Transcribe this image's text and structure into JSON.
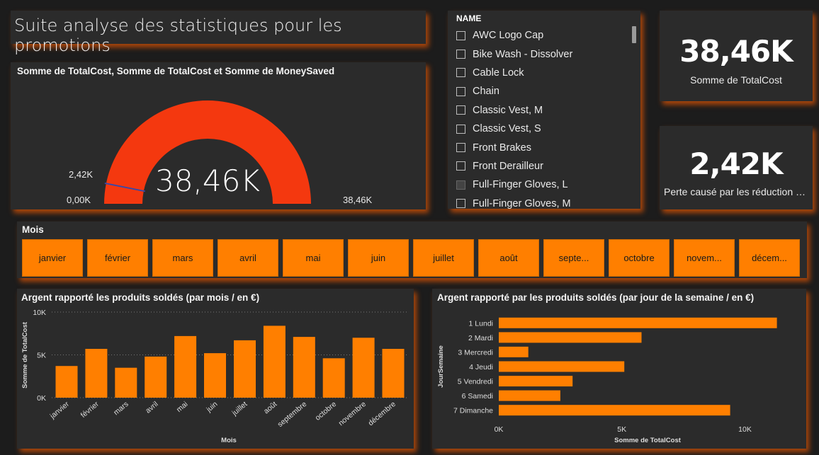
{
  "header": {
    "title": "Suite analyse des statistiques pour les promotions"
  },
  "gauge": {
    "title": "Somme de TotalCost, Somme de TotalCost et Somme de MoneySaved",
    "value_label": "38,46K",
    "min_label": "0,00K",
    "max_label": "38,46K",
    "target_label": "2,42K",
    "value": 38.46,
    "target": 2.42,
    "max": 38.46,
    "color": "#f4380f"
  },
  "slicer": {
    "header": "NAME",
    "items": [
      {
        "label": "AWC Logo Cap",
        "dark": false
      },
      {
        "label": "Bike Wash - Dissolver",
        "dark": false
      },
      {
        "label": "Cable Lock",
        "dark": false
      },
      {
        "label": "Chain",
        "dark": false
      },
      {
        "label": "Classic Vest, M",
        "dark": false
      },
      {
        "label": "Classic Vest, S",
        "dark": false
      },
      {
        "label": "Front Brakes",
        "dark": false
      },
      {
        "label": "Front Derailleur",
        "dark": false
      },
      {
        "label": "Full-Finger Gloves, L",
        "dark": true
      },
      {
        "label": "Full-Finger Gloves, M",
        "dark": false
      }
    ]
  },
  "card1": {
    "value": "38,46K",
    "label": "Somme de TotalCost"
  },
  "card2": {
    "value": "2,42K",
    "label": "Perte causé par les réduction (e..."
  },
  "months": {
    "title": "Mois",
    "items": [
      "janvier",
      "février",
      "mars",
      "avril",
      "mai",
      "juin",
      "juillet",
      "août",
      "septe...",
      "octobre",
      "novem...",
      "décem..."
    ]
  },
  "colors": {
    "accent": "#ff7f00",
    "gauge": "#f4380f",
    "panel": "#2b2b2b",
    "glow": "#c44e08"
  },
  "chart_data": [
    {
      "type": "bar",
      "title": "Argent rapporté les produits soldés (par mois / en €)",
      "xlabel": "Mois",
      "ylabel": "Somme de TotalCost",
      "categories": [
        "janvier",
        "février",
        "mars",
        "avril",
        "mai",
        "juin",
        "juillet",
        "août",
        "septembre",
        "octobre",
        "novembre",
        "décembre"
      ],
      "values": [
        3700,
        5700,
        3500,
        4800,
        7200,
        5200,
        6700,
        8400,
        7100,
        4600,
        7000,
        5700
      ],
      "ylim": [
        0,
        10000
      ],
      "yticks": [
        "0K",
        "5K",
        "10K"
      ],
      "color": "#ff7f00"
    },
    {
      "type": "bar",
      "orientation": "horizontal",
      "title": "Argent rapporté par les produits soldés (par jour de la semaine / en €)",
      "xlabel": "Somme de TotalCost",
      "ylabel": "JourSemaine",
      "categories": [
        "1 Lundi",
        "2 Mardi",
        "3 Mercredi",
        "4 Jeudi",
        "5 Vendredi",
        "6 Samedi",
        "7 Dimanche"
      ],
      "values": [
        11300,
        5800,
        1200,
        5100,
        3000,
        2500,
        9400
      ],
      "xlim": [
        0,
        11800
      ],
      "xticks": [
        "0K",
        "5K",
        "10K"
      ],
      "color": "#ff7f00"
    }
  ]
}
